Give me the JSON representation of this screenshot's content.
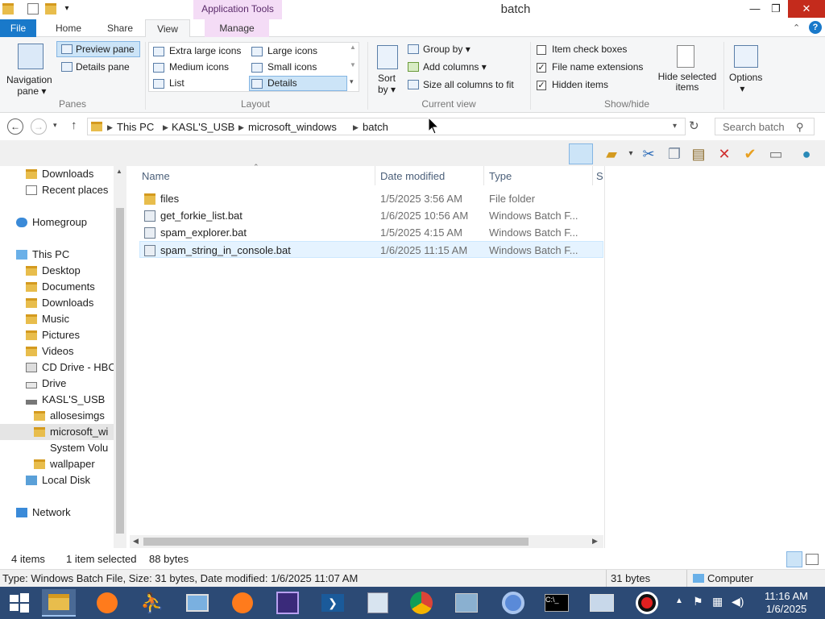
{
  "window": {
    "title": "batch",
    "context_tab_label": "Application Tools",
    "controls": {
      "minimize": "—",
      "maximize": "❐",
      "close": "✕"
    }
  },
  "ribbon": {
    "tabs": [
      "File",
      "Home",
      "Share",
      "View",
      "Manage"
    ],
    "active_tab": "View",
    "panes": {
      "navigation_pane": "Navigation pane",
      "preview_pane": "Preview pane",
      "details_pane": "Details pane",
      "group": "Panes"
    },
    "layout": {
      "options": [
        "Extra large icons",
        "Large icons",
        "Medium icons",
        "Small icons",
        "List",
        "Details"
      ],
      "selected": "Details",
      "group": "Layout"
    },
    "current_view": {
      "sort_by": "Sort by",
      "group_by": "Group by",
      "add_columns": "Add columns",
      "size_all": "Size all columns to fit",
      "group": "Current view"
    },
    "show_hide": {
      "item_check_boxes": {
        "label": "Item check boxes",
        "checked": false
      },
      "file_name_extensions": {
        "label": "File name extensions",
        "checked": true
      },
      "hidden_items": {
        "label": "Hidden items",
        "checked": true
      },
      "hide_selected": "Hide selected items",
      "group": "Show/hide"
    },
    "options": "Options"
  },
  "address": {
    "breadcrumbs": [
      "This PC",
      "KASL'S_USB",
      "microsoft_windows",
      "batch"
    ],
    "search_placeholder": "Search batch"
  },
  "nav": {
    "items": [
      {
        "label": "Downloads",
        "icon": "downloads-folder-icon"
      },
      {
        "label": "Recent places",
        "icon": "recent-places-icon"
      },
      {
        "label": "Homegroup",
        "icon": "homegroup-icon"
      },
      {
        "label": "This PC",
        "icon": "computer-icon"
      },
      {
        "label": "Desktop",
        "icon": "folder-icon"
      },
      {
        "label": "Documents",
        "icon": "folder-icon"
      },
      {
        "label": "Downloads",
        "icon": "downloads-folder-icon"
      },
      {
        "label": "Music",
        "icon": "music-folder-icon"
      },
      {
        "label": "Pictures",
        "icon": "pictures-folder-icon"
      },
      {
        "label": "Videos",
        "icon": "videos-folder-icon"
      },
      {
        "label": "CD Drive - HBC",
        "icon": "cd-drive-icon"
      },
      {
        "label": "Drive",
        "icon": "drive-icon"
      },
      {
        "label": "KASL'S_USB",
        "icon": "usb-drive-icon"
      },
      {
        "label": "allosesimgs",
        "icon": "folder-icon"
      },
      {
        "label": "microsoft_wi",
        "icon": "folder-icon"
      },
      {
        "label": "System Volu",
        "icon": "folder-icon"
      },
      {
        "label": "wallpaper",
        "icon": "folder-icon"
      },
      {
        "label": "Local Disk",
        "icon": "local-disk-icon"
      },
      {
        "label": "Network",
        "icon": "network-icon"
      }
    ]
  },
  "files": {
    "columns": [
      "Name",
      "Date modified",
      "Type",
      "S"
    ],
    "rows": [
      {
        "name": "files",
        "date": "1/5/2025 3:56 AM",
        "type": "File folder",
        "icon": "folder-icon"
      },
      {
        "name": "get_forkie_list.bat",
        "date": "1/6/2025 10:56 AM",
        "type": "Windows Batch F...",
        "icon": "batch-file-icon"
      },
      {
        "name": "spam_explorer.bat",
        "date": "1/5/2025 4:15 AM",
        "type": "Windows Batch F...",
        "icon": "batch-file-icon"
      },
      {
        "name": "spam_string_in_console.bat",
        "date": "1/6/2025 11:15 AM",
        "type": "Windows Batch F...",
        "icon": "batch-file-icon"
      }
    ],
    "selected_index": 3
  },
  "status": {
    "items_count": "4 items",
    "selected": "1 item selected",
    "size": "88 bytes"
  },
  "infobar": {
    "details": "Type: Windows Batch File, Size: 31 bytes, Date modified: 1/6/2025 11:07 AM",
    "size": "31 bytes",
    "location": "Computer"
  },
  "taskbar": {
    "time": "11:16 AM",
    "date": "1/6/2025"
  }
}
